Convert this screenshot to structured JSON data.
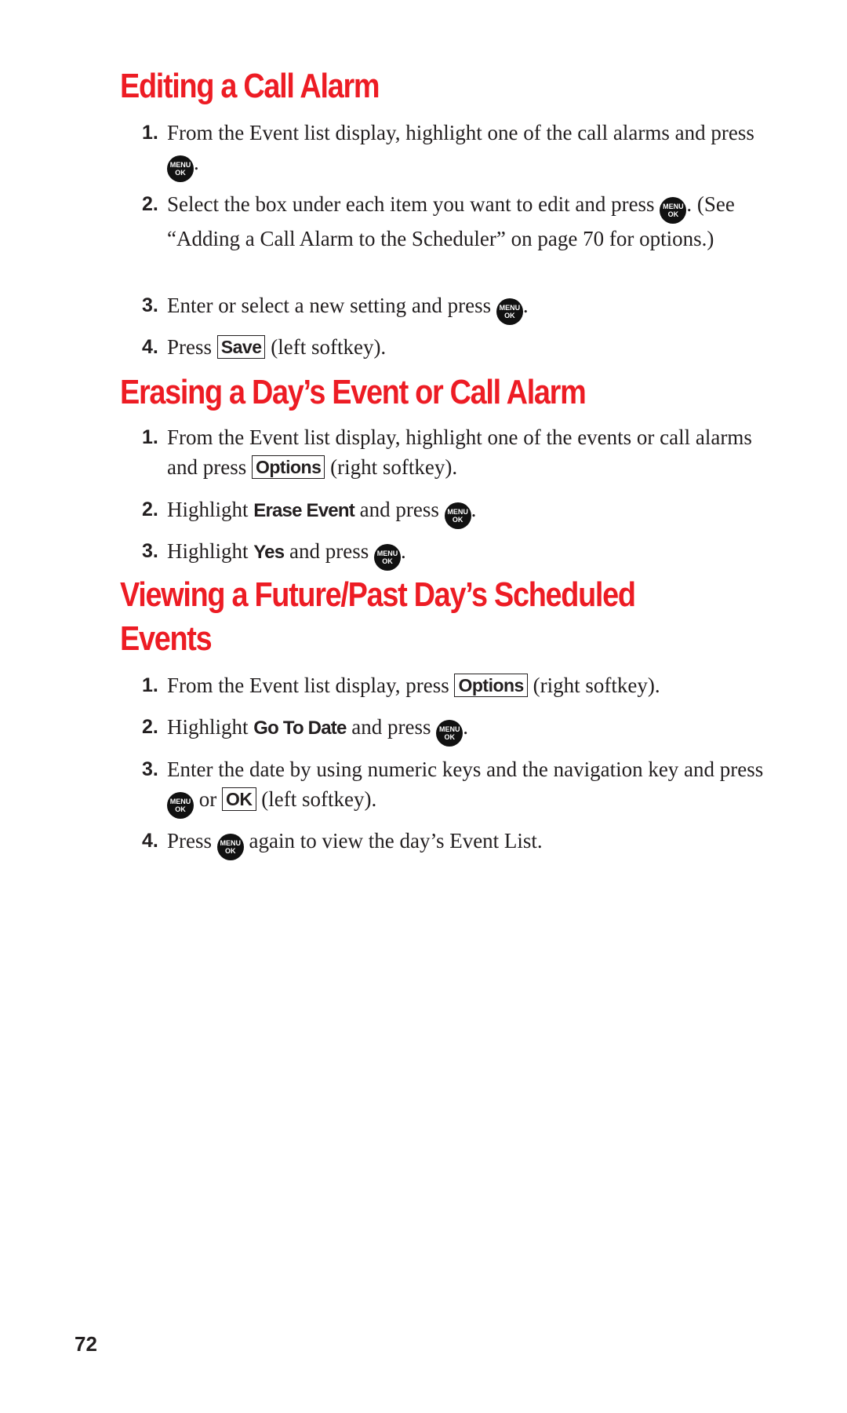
{
  "sections": [
    {
      "title": "Editing a Call Alarm",
      "steps": [
        {
          "num": "1.",
          "a": "From the Event list display, highlight one of the call alarms and press ",
          "b": "."
        },
        {
          "num": "2.",
          "a": "Select the box under each item you want to edit and press ",
          "b": ". (See “Adding a Call Alarm to the Scheduler” on page 70 for options.)"
        },
        {
          "num": "3.",
          "a": "Enter or select a new setting and press ",
          "b": "."
        },
        {
          "num": "4.",
          "a": "Press ",
          "key": "Save",
          "b": " (left softkey)."
        }
      ]
    },
    {
      "title": "Erasing a Day’s Event or Call Alarm",
      "steps": [
        {
          "num": "1.",
          "a": "From the Event list display, highlight one of the events or call alarms and press ",
          "key": "Options",
          "b": " (right softkey)."
        },
        {
          "num": "2.",
          "a": "Highlight ",
          "bold": "Erase Event",
          "c": " and press ",
          "b": "."
        },
        {
          "num": "3.",
          "a": "Highlight ",
          "bold": "Yes",
          "c": " and press ",
          "b": "."
        }
      ]
    },
    {
      "title_line1": "Viewing a Future/Past Day’s Scheduled",
      "title_line2": "Events",
      "steps": [
        {
          "num": "1.",
          "a": "From the Event list display, press ",
          "key": "Options",
          "b": " (right softkey)."
        },
        {
          "num": "2.",
          "a": "Highlight ",
          "bold": "Go To Date",
          "c": " and press ",
          "b": "."
        },
        {
          "num": "3.",
          "a": "Enter the date by using numeric keys and the navigation key and press ",
          "c": " or ",
          "key": "OK",
          "b": " (left softkey)."
        },
        {
          "num": "4.",
          "a": "Press ",
          "b": " again to view the day’s Event List."
        }
      ]
    }
  ],
  "menu_ok_icon": {
    "line1": "MENU",
    "line2": "OK"
  },
  "page_number": "72"
}
